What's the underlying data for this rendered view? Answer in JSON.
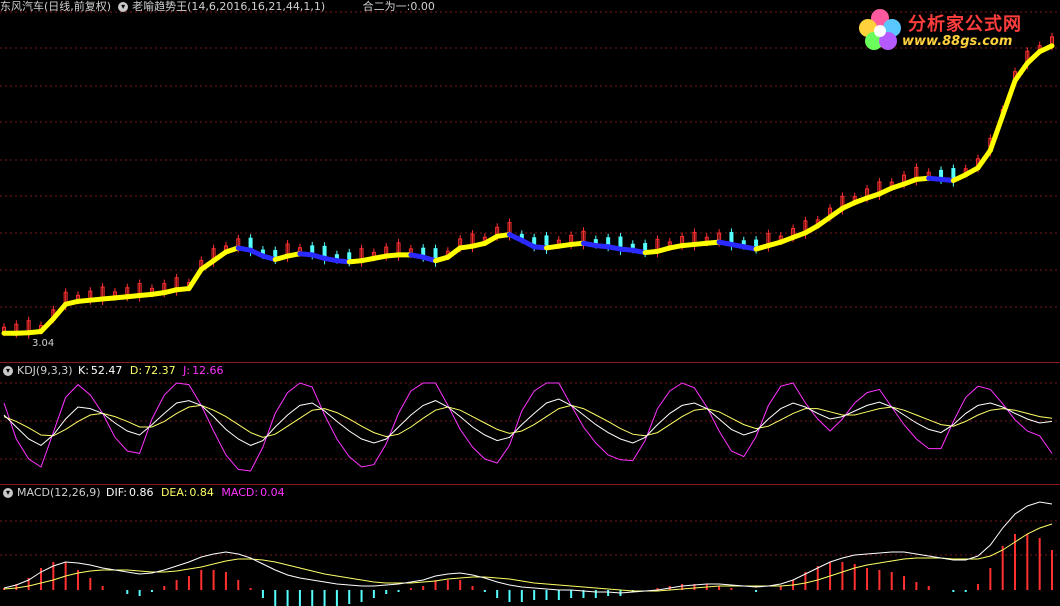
{
  "main": {
    "title": "东风汽车(日线,前复权)",
    "indicator": "老喻趋势王",
    "params": "(14,6,2016,16,21,44,1,1)",
    "extra_label": "合二为一:",
    "extra_value": "0.00",
    "min_price_label": "3.04"
  },
  "logo": {
    "name": "分析家公式网",
    "url": "www.88gs.com"
  },
  "kdj": {
    "label": "KDJ(9,3,3)",
    "k_label": "K:",
    "k_value": "52.47",
    "d_label": "D:",
    "d_value": "72.37",
    "j_label": "J:",
    "j_value": "12.66"
  },
  "macd": {
    "label": "MACD(12,26,9)",
    "dif_label": "DIF:",
    "dif_value": "0.86",
    "dea_label": "DEA:",
    "dea_value": "0.84",
    "macd_label": "MACD:",
    "macd_value": "0.04"
  },
  "colors": {
    "background": "#000000",
    "grid": "#7a1a1a",
    "trend_up": "#ffff00",
    "trend_down": "#2a2aff",
    "candle_up": "#ff3030",
    "candle_down": "#55ffff",
    "k_line": "#ffffff",
    "d_line": "#ffff66",
    "j_line": "#ff33ff",
    "hist_up": "#ff3030",
    "hist_down": "#55ffff"
  },
  "chart_data": {
    "type": "line",
    "main_trend": [
      3.05,
      3.05,
      3.06,
      3.08,
      3.3,
      3.55,
      3.6,
      3.62,
      3.64,
      3.66,
      3.68,
      3.7,
      3.72,
      3.75,
      3.8,
      3.82,
      4.15,
      4.3,
      4.45,
      4.52,
      4.48,
      4.38,
      4.32,
      4.38,
      4.42,
      4.4,
      4.34,
      4.3,
      4.28,
      4.3,
      4.34,
      4.38,
      4.4,
      4.4,
      4.36,
      4.3,
      4.36,
      4.52,
      4.55,
      4.6,
      4.72,
      4.75,
      4.65,
      4.54,
      4.52,
      4.55,
      4.58,
      4.6,
      4.56,
      4.54,
      4.5,
      4.48,
      4.44,
      4.46,
      4.52,
      4.56,
      4.58,
      4.6,
      4.62,
      4.58,
      4.54,
      4.5,
      4.56,
      4.62,
      4.7,
      4.78,
      4.9,
      5.05,
      5.2,
      5.3,
      5.38,
      5.45,
      5.55,
      5.62,
      5.7,
      5.72,
      5.7,
      5.68,
      5.78,
      5.9,
      6.2,
      6.8,
      7.4,
      7.7,
      7.9,
      8.0
    ],
    "k": [
      60,
      45,
      30,
      22,
      35,
      55,
      70,
      68,
      62,
      50,
      40,
      35,
      48,
      62,
      75,
      78,
      72,
      58,
      42,
      30,
      22,
      28,
      45,
      60,
      72,
      75,
      65,
      52,
      40,
      30,
      25,
      30,
      45,
      60,
      72,
      78,
      70,
      58,
      45,
      35,
      28,
      32,
      48,
      62,
      75,
      80,
      72,
      60,
      48,
      38,
      30,
      25,
      32,
      48,
      62,
      72,
      75,
      68,
      55,
      42,
      35,
      40,
      55,
      68,
      75,
      70,
      62,
      55,
      58,
      65,
      72,
      76,
      70,
      60,
      50,
      42,
      38,
      48,
      62,
      72,
      75,
      70,
      62,
      55,
      50,
      52
    ],
    "d": [
      58,
      52,
      44,
      35,
      34,
      42,
      52,
      60,
      62,
      58,
      52,
      45,
      45,
      52,
      62,
      70,
      72,
      66,
      58,
      48,
      38,
      32,
      36,
      46,
      56,
      66,
      68,
      63,
      55,
      46,
      38,
      33,
      36,
      45,
      56,
      66,
      70,
      66,
      58,
      50,
      42,
      37,
      40,
      48,
      58,
      68,
      72,
      68,
      60,
      52,
      43,
      36,
      34,
      38,
      48,
      58,
      66,
      68,
      64,
      56,
      48,
      43,
      46,
      54,
      62,
      68,
      68,
      64,
      60,
      60,
      64,
      68,
      70,
      66,
      60,
      54,
      48,
      46,
      52,
      60,
      66,
      68,
      66,
      62,
      58,
      56
    ],
    "j": [
      75,
      30,
      5,
      -5,
      38,
      82,
      98,
      85,
      62,
      32,
      15,
      12,
      55,
      85,
      100,
      98,
      72,
      40,
      10,
      -8,
      -10,
      20,
      62,
      88,
      100,
      95,
      60,
      30,
      8,
      -5,
      -2,
      24,
      62,
      90,
      100,
      100,
      72,
      42,
      20,
      5,
      0,
      22,
      65,
      90,
      100,
      100,
      72,
      45,
      25,
      10,
      4,
      3,
      28,
      68,
      90,
      100,
      94,
      70,
      40,
      15,
      8,
      33,
      72,
      96,
      100,
      75,
      55,
      40,
      55,
      75,
      88,
      92,
      70,
      48,
      30,
      18,
      18,
      52,
      82,
      96,
      92,
      74,
      54,
      40,
      34,
      12
    ],
    "dif": [
      0.02,
      0.05,
      0.1,
      0.18,
      0.24,
      0.28,
      0.27,
      0.25,
      0.22,
      0.2,
      0.18,
      0.16,
      0.17,
      0.2,
      0.24,
      0.28,
      0.33,
      0.36,
      0.38,
      0.36,
      0.32,
      0.26,
      0.2,
      0.15,
      0.12,
      0.1,
      0.08,
      0.06,
      0.05,
      0.04,
      0.04,
      0.05,
      0.06,
      0.08,
      0.1,
      0.14,
      0.16,
      0.17,
      0.15,
      0.12,
      0.08,
      0.05,
      0.03,
      0.02,
      0.01,
      0.0,
      0.0,
      -0.01,
      -0.02,
      -0.02,
      -0.03,
      -0.02,
      -0.01,
      0.0,
      0.02,
      0.04,
      0.05,
      0.06,
      0.06,
      0.05,
      0.04,
      0.03,
      0.04,
      0.06,
      0.1,
      0.16,
      0.22,
      0.28,
      0.32,
      0.35,
      0.36,
      0.37,
      0.38,
      0.38,
      0.36,
      0.34,
      0.32,
      0.3,
      0.3,
      0.34,
      0.45,
      0.62,
      0.76,
      0.84,
      0.88,
      0.86
    ],
    "dea": [
      0.01,
      0.02,
      0.04,
      0.07,
      0.1,
      0.14,
      0.17,
      0.19,
      0.2,
      0.2,
      0.2,
      0.19,
      0.18,
      0.18,
      0.19,
      0.21,
      0.23,
      0.26,
      0.29,
      0.31,
      0.31,
      0.3,
      0.28,
      0.25,
      0.22,
      0.19,
      0.16,
      0.14,
      0.12,
      0.1,
      0.08,
      0.07,
      0.07,
      0.07,
      0.08,
      0.09,
      0.11,
      0.12,
      0.13,
      0.13,
      0.12,
      0.11,
      0.09,
      0.07,
      0.06,
      0.05,
      0.04,
      0.03,
      0.02,
      0.01,
      0.0,
      -0.01,
      -0.01,
      -0.01,
      0.0,
      0.01,
      0.02,
      0.03,
      0.04,
      0.04,
      0.04,
      0.04,
      0.04,
      0.04,
      0.05,
      0.07,
      0.1,
      0.14,
      0.18,
      0.22,
      0.25,
      0.27,
      0.29,
      0.31,
      0.32,
      0.32,
      0.32,
      0.31,
      0.31,
      0.31,
      0.34,
      0.4,
      0.48,
      0.56,
      0.62,
      0.66
    ]
  }
}
